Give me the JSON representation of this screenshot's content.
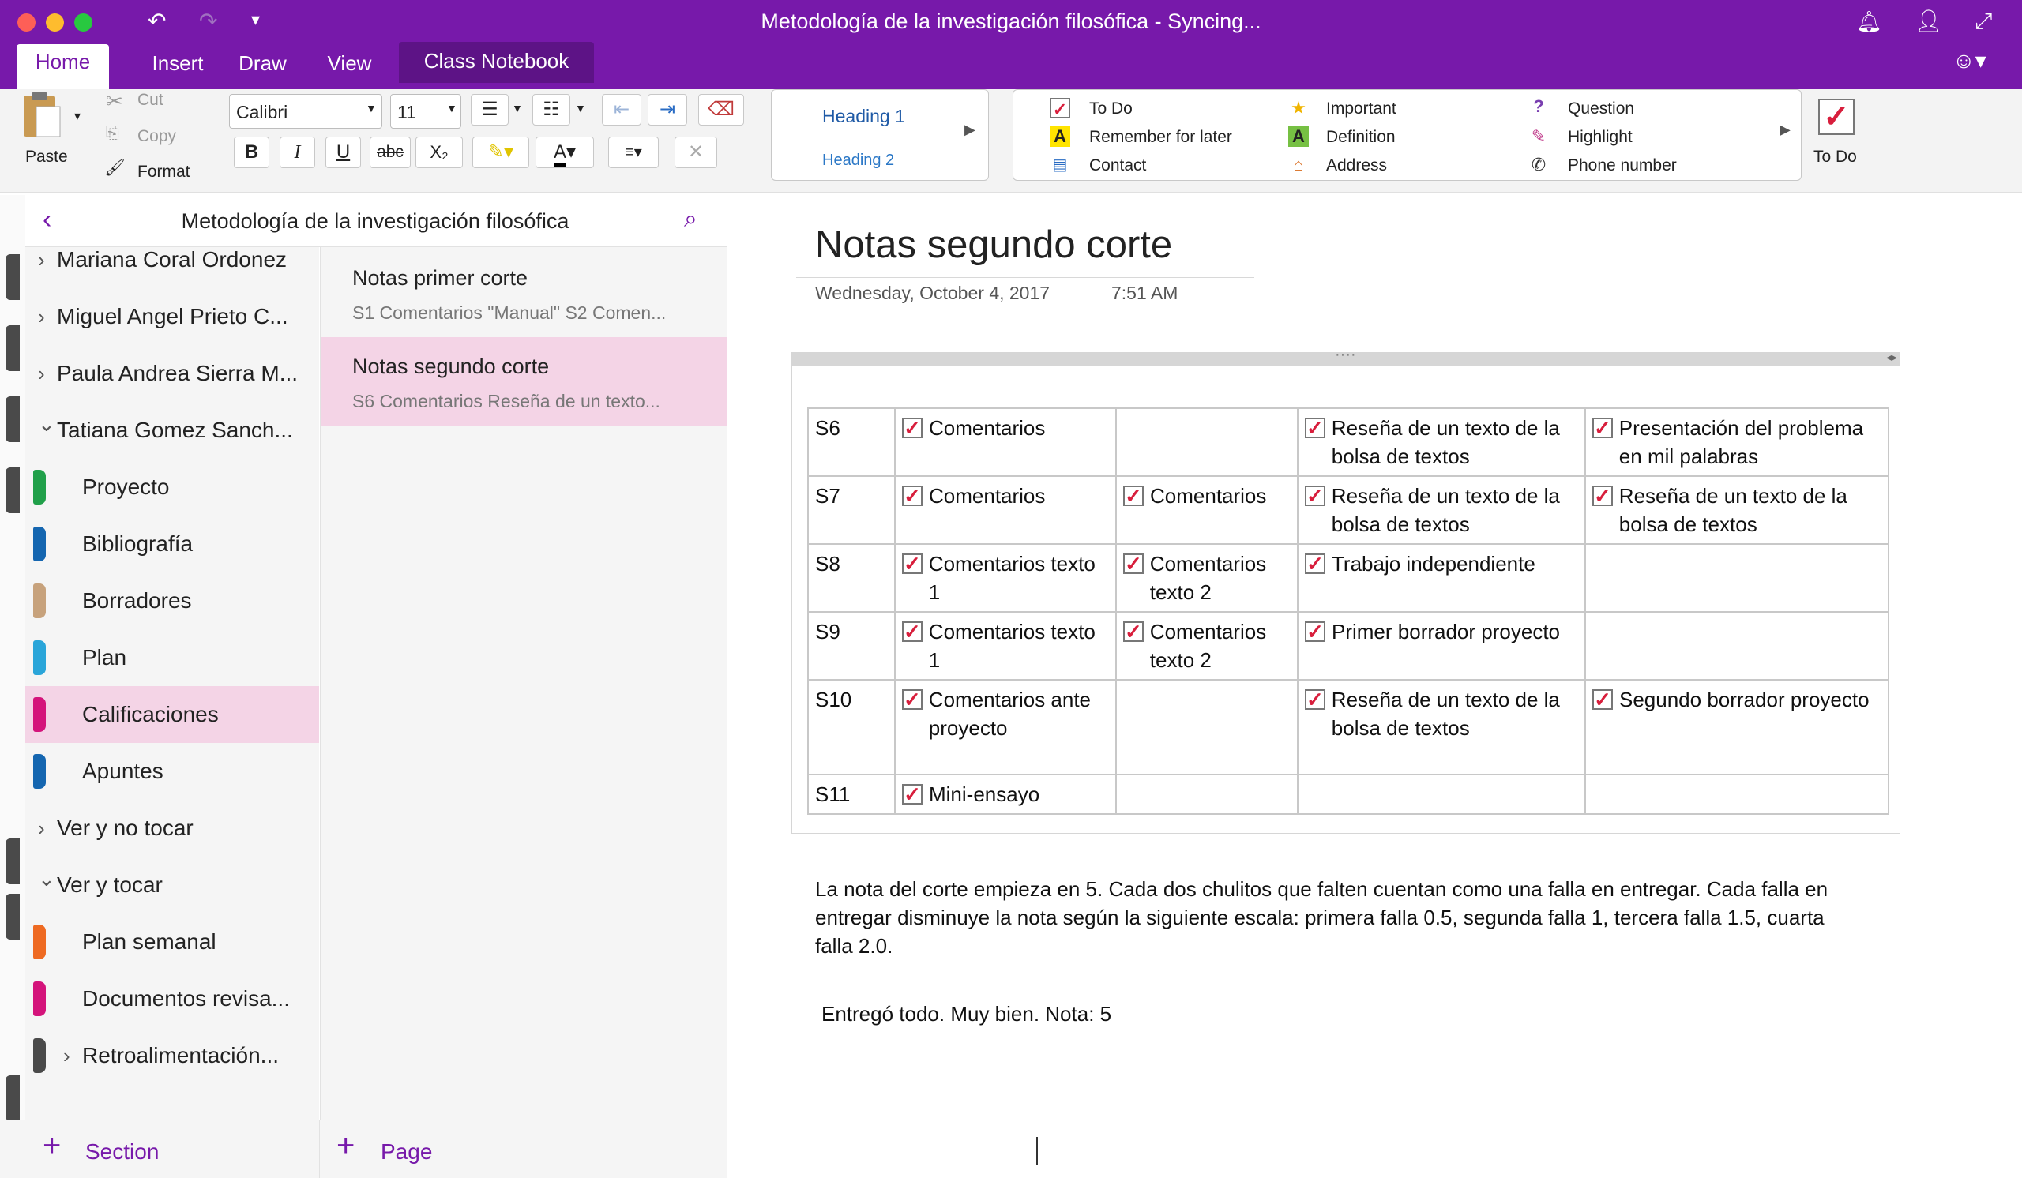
{
  "window": {
    "title": "Metodología de la investigación filosófica - Syncing..."
  },
  "tabs": {
    "home": "Home",
    "insert": "Insert",
    "draw": "Draw",
    "view": "View",
    "class_notebook": "Class Notebook"
  },
  "ribbon": {
    "paste": "Paste",
    "cut": "Cut",
    "copy": "Copy",
    "format": "Format",
    "font": "Calibri",
    "size": "11",
    "bold": "B",
    "italic": "I",
    "underline": "U",
    "strike": "abc",
    "subscript": "X₂",
    "styles": {
      "h1": "Heading 1",
      "h2": "Heading 2"
    },
    "tags": {
      "todo": "To Do",
      "remember": "Remember for later",
      "contact": "Contact",
      "important": "Important",
      "definition": "Definition",
      "address": "Address",
      "question": "Question",
      "highlight": "Highlight",
      "phone": "Phone number"
    },
    "todo_button": "To Do"
  },
  "nav": {
    "notebook_title": "Metodología de la investigación filosófica",
    "sections": [
      {
        "label": "Mariana Coral Ordonez",
        "type": "group",
        "expanded": false
      },
      {
        "label": "Miguel Angel Prieto C...",
        "type": "group",
        "expanded": false
      },
      {
        "label": "Paula Andrea Sierra M...",
        "type": "group",
        "expanded": false
      },
      {
        "label": "Tatiana Gomez Sanch...",
        "type": "group",
        "expanded": true
      },
      {
        "label": "Proyecto",
        "type": "section",
        "color": "#21a04a"
      },
      {
        "label": "Bibliografía",
        "type": "section",
        "color": "#1566b0"
      },
      {
        "label": "Borradores",
        "type": "section",
        "color": "#c7a27c"
      },
      {
        "label": "Plan",
        "type": "section",
        "color": "#2aa5d9"
      },
      {
        "label": "Calificaciones",
        "type": "section",
        "color": "#d4147b",
        "selected": true
      },
      {
        "label": "Apuntes",
        "type": "section",
        "color": "#1566b0"
      },
      {
        "label": "Ver y no tocar",
        "type": "group",
        "expanded": false
      },
      {
        "label": "Ver y tocar",
        "type": "group",
        "expanded": true
      },
      {
        "label": "Plan semanal",
        "type": "section",
        "color": "#ee6a22"
      },
      {
        "label": "Documentos revisa...",
        "type": "section",
        "color": "#d4147b"
      },
      {
        "label": "Retroalimentación...",
        "type": "subgroup",
        "color": "#4a4a4a"
      }
    ],
    "pages": [
      {
        "title": "Notas primer corte",
        "preview": "S1  Comentarios  \"Manual\"  S2  Comen..."
      },
      {
        "title": "Notas segundo corte",
        "preview": "S6  Comentarios  Reseña de un texto...",
        "selected": true
      }
    ],
    "add_section": "Section",
    "add_page": "Page"
  },
  "page": {
    "title": "Notas segundo corte",
    "date": "Wednesday, October 4, 2017",
    "time": "7:51 AM",
    "table": [
      [
        "S6",
        "Comentarios",
        "",
        "Reseña de un texto de la bolsa de textos",
        " Presentación del problema en mil palabras"
      ],
      [
        "S7",
        "Comentarios",
        "Comentarios",
        "Reseña de un texto de la bolsa de textos",
        "Reseña de un texto de la bolsa de textos"
      ],
      [
        "S8",
        "Comentarios texto 1",
        "Comentarios texto 2",
        "Trabajo independiente",
        ""
      ],
      [
        "S9",
        "Comentarios texto 1",
        "Comentarios texto 2",
        "Primer borrador proyecto",
        ""
      ],
      [
        "S10",
        "Comentarios ante proyecto",
        "",
        "Reseña de un texto de la bolsa de textos",
        "Segundo borrador proyecto"
      ],
      [
        "S11",
        "Mini-ensayo",
        "",
        "",
        ""
      ]
    ],
    "paragraph": "La nota del corte empieza en 5. Cada dos chulitos que falten cuentan como una falla en entregar. Cada falla en entregar disminuye la nota según la siguiente escala: primera falla 0.5, segunda falla 1, tercera falla 1.5, cuarta falla 2.0.",
    "final_note": "Entregó todo. Muy bien. Nota: 5"
  },
  "colors": {
    "accent": "#7719aa",
    "checkmark": "#d81e3c",
    "selected_bg": "#f4d4e6"
  }
}
